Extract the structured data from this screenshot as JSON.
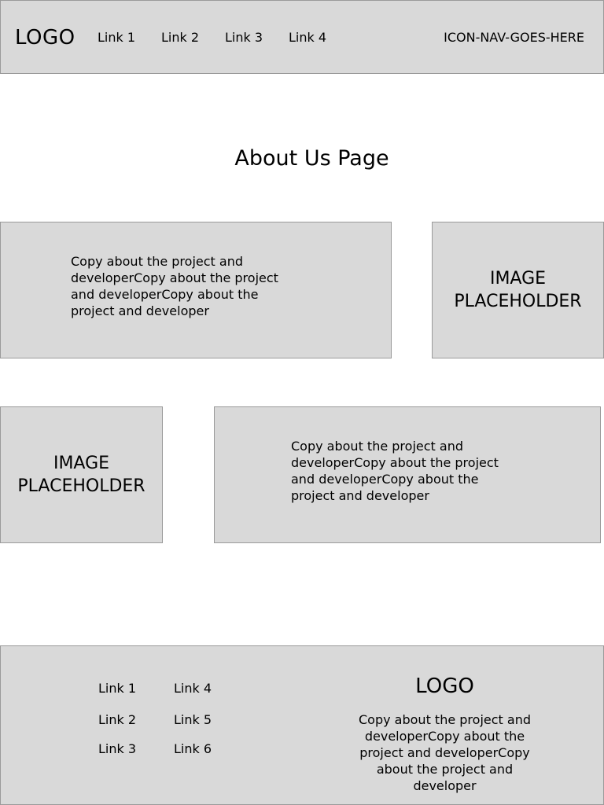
{
  "header": {
    "logo": "LOGO",
    "nav": [
      "Link 1",
      "Link 2",
      "Link 3",
      "Link 4"
    ],
    "icon_nav": "ICON-NAV-GOES-HERE"
  },
  "page_title": "About Us Page",
  "row1": {
    "copy": "Copy about the project and developerCopy about the project and developerCopy about the project and developer",
    "image": "IMAGE PLACEHOLDER"
  },
  "row2": {
    "image": "IMAGE PLACEHOLDER",
    "copy": "Copy about the project and developerCopy about the project and developerCopy about the project and developer"
  },
  "footer": {
    "links": [
      "Link 1",
      "Link 2",
      "Link 3",
      "Link 4",
      "Link 5",
      "Link 6"
    ],
    "logo": "LOGO",
    "copy": "Copy about the project and developerCopy about the project and developerCopy about the project and developer"
  }
}
